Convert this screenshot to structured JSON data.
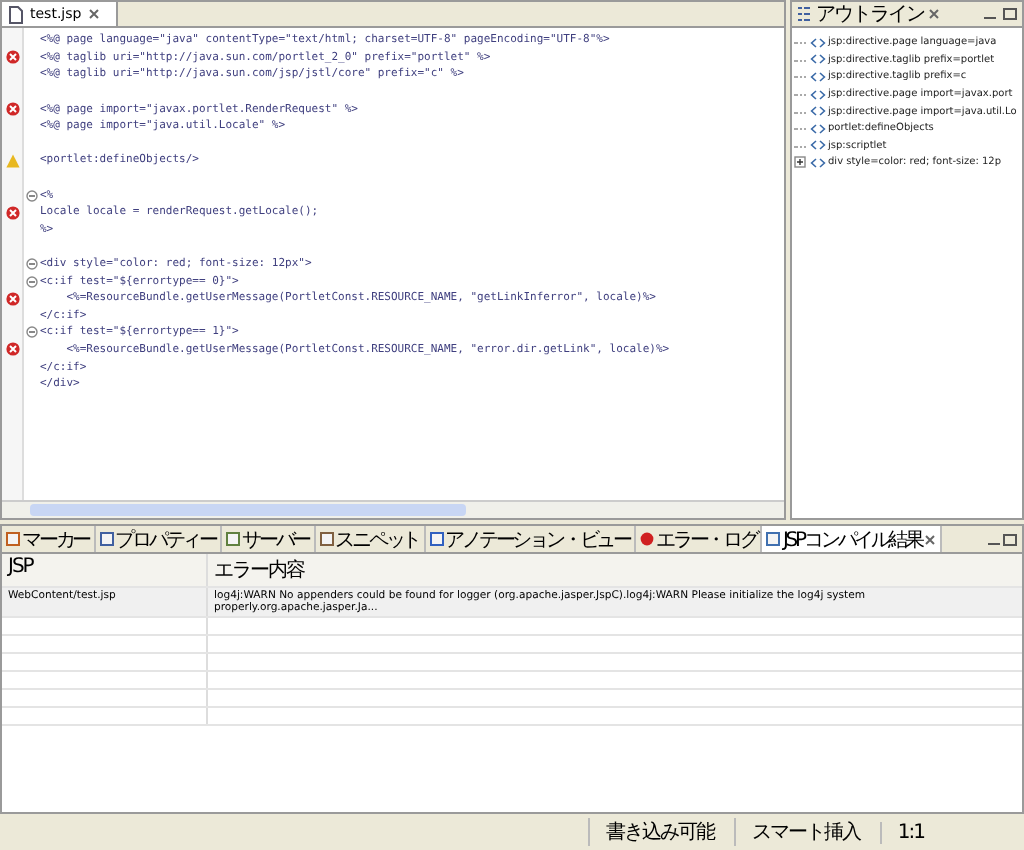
{
  "editor": {
    "tab": {
      "label": "test.jsp",
      "selected": true
    },
    "lines": [
      {
        "text": "<%@ page language=\"java\" contentType=\"text/html; charset=UTF-8\" pageEncoding=\"UTF-8\"%>",
        "error": false,
        "warning": false,
        "fold": false
      },
      {
        "text": "<%@ taglib uri=\"http://java.sun.com/portlet_2_0\" prefix=\"portlet\" %>",
        "error": true,
        "warning": false,
        "fold": false
      },
      {
        "text": "<%@ taglib uri=\"http://java.sun.com/jsp/jstl/core\" prefix=\"c\" %>",
        "error": false,
        "warning": false,
        "fold": false
      },
      {
        "error": false,
        "warning": false,
        "fold": false
      },
      {
        "text": "<%@ page import=\"javax.portlet.RenderRequest\" %>",
        "error": true,
        "warning": false,
        "fold": false
      },
      {
        "text": "<%@ page import=\"java.util.Locale\" %>",
        "error": false,
        "warning": false,
        "fold": false
      },
      {
        "error": false,
        "warning": false,
        "fold": false
      },
      {
        "text": "<portlet:defineObjects/>",
        "error": false,
        "warning": true,
        "fold": false
      },
      {
        "error": false,
        "warning": false,
        "fold": false
      },
      {
        "text": "<%",
        "error": false,
        "warning": false,
        "fold": true
      },
      {
        "text": "Locale locale = renderRequest.getLocale();",
        "error": true,
        "warning": false,
        "fold": false
      },
      {
        "text": "%>",
        "error": false,
        "warning": false,
        "fold": false
      },
      {
        "error": false,
        "warning": false,
        "fold": false
      },
      {
        "text": "<div style=\"color: red; font-size: 12px\">",
        "error": false,
        "warning": false,
        "fold": true
      },
      {
        "text": "<c:if test=\"${errortype== 0}\">",
        "error": false,
        "warning": false,
        "fold": true
      },
      {
        "text": "    <%=ResourceBundle.getUserMessage(PortletConst.RESOURCE_NAME, \"getLinkInferror\", locale)%>",
        "error": true,
        "warning": false,
        "fold": false
      },
      {
        "text": "</c:if>",
        "error": false,
        "warning": false,
        "fold": false
      },
      {
        "text": "<c:if test=\"${errortype== 1}\">",
        "error": false,
        "warning": false,
        "fold": true
      },
      {
        "text": "    <%=ResourceBundle.getUserMessage(PortletConst.RESOURCE_NAME, \"error.dir.getLink\", locale)%>",
        "error": true,
        "warning": false,
        "fold": false
      },
      {
        "text": "</c:if>",
        "error": false,
        "warning": false,
        "fold": false
      },
      {
        "text": "</div>",
        "error": false,
        "warning": false,
        "fold": false
      }
    ]
  },
  "outline": {
    "title": "アウトライン",
    "items": [
      {
        "label": "jsp:directive.page language=java",
        "kind": "leaf"
      },
      {
        "label": "jsp:directive.taglib prefix=portlet",
        "kind": "leaf"
      },
      {
        "label": "jsp:directive.taglib prefix=c",
        "kind": "leaf"
      },
      {
        "label": "jsp:directive.page import=javax.port",
        "kind": "leaf"
      },
      {
        "label": "jsp:directive.page import=java.util.Lo",
        "kind": "leaf"
      },
      {
        "label": "portlet:defineObjects",
        "kind": "leaf"
      },
      {
        "label": "jsp:scriptlet",
        "kind": "leaf"
      },
      {
        "label": "div style=color: red; font-size: 12p",
        "kind": "collapsed"
      }
    ]
  },
  "bottom_tabs": [
    {
      "label": "マーカー",
      "selected": false
    },
    {
      "label": "プロパティー",
      "selected": false
    },
    {
      "label": "サーバー",
      "selected": false
    },
    {
      "label": "スニペット",
      "selected": false
    },
    {
      "label": "アノテーション・ビュー",
      "selected": false
    },
    {
      "label": "エラー・ログ",
      "selected": false
    },
    {
      "label": "JSPコンパイル結果",
      "selected": true
    }
  ],
  "table": {
    "columns": [
      "JSP",
      "エラー内容"
    ],
    "rows": [
      [
        "WebContent/test.jsp",
        "log4j:WARN No appenders could be found for logger (org.apache.jasper.JspC).log4j:WARN Please initialize the log4j system properly.org.apache.jasper.Ja..."
      ]
    ]
  },
  "status_bar": [
    "書き込み可能",
    "スマート挿入",
    "1:1"
  ]
}
